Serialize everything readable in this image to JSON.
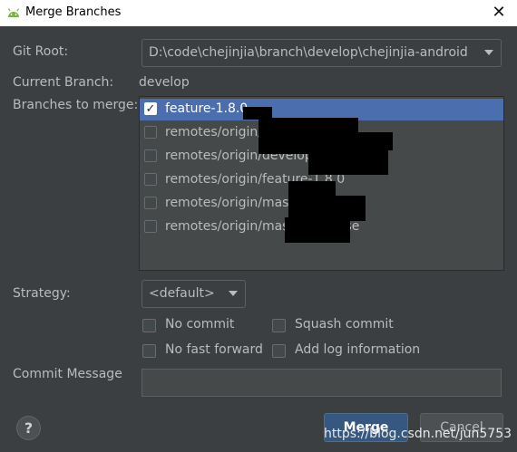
{
  "window": {
    "title": "Merge Branches",
    "close_glyph": "✕",
    "app_icon": "android-icon"
  },
  "labels": {
    "git_root": "Git Root:",
    "current_branch": "Current Branch:",
    "current_branch_value": "develop",
    "branches_to_merge": "Branches to merge:",
    "strategy": "Strategy:",
    "commit_message": "Commit Message"
  },
  "git_root": {
    "value": "D:\\code\\chejinjia\\branch\\develop\\chejinjia-android"
  },
  "branches": [
    {
      "label": "feature-1.8.0",
      "checked": true,
      "selected": true
    },
    {
      "label": "remotes/origin/develop",
      "checked": false,
      "selected": false
    },
    {
      "label": "remotes/origin/develop_release",
      "checked": false,
      "selected": false
    },
    {
      "label": "remotes/origin/feature-1.8.0",
      "checked": false,
      "selected": false
    },
    {
      "label": "remotes/origin/master",
      "checked": false,
      "selected": false
    },
    {
      "label": "remotes/origin/master_release",
      "checked": false,
      "selected": false
    }
  ],
  "strategy": {
    "value": "<default>"
  },
  "options": {
    "no_commit": "No commit",
    "squash_commit": "Squash commit",
    "no_fast_forward": "No fast forward",
    "add_log_information": "Add log information"
  },
  "commit_message": {
    "value": ""
  },
  "buttons": {
    "help": "?",
    "merge": "Merge",
    "cancel": "Cancel"
  },
  "watermark": "https://blog.csdn.net/jun5753",
  "colors": {
    "background": "#3c3f41",
    "selection": "#4b6eaf",
    "primary_button": "#365880"
  }
}
